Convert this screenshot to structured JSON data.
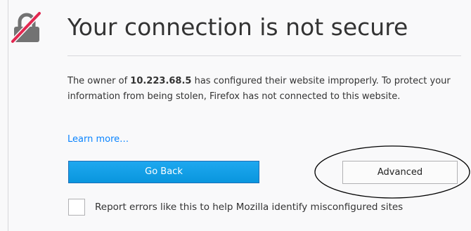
{
  "page": {
    "title": "Your connection is not secure",
    "description": {
      "before_host": "The owner of ",
      "host": "10.223.68.5",
      "after_host": " has configured their website improperly. To protect your information from being stolen, Firefox has not connected to this website."
    },
    "learn_more": "Learn more…",
    "go_back_label": "Go Back",
    "advanced_label": "Advanced",
    "report_label": "Report errors like this to help Mozilla identify misconfigured sites",
    "report_checked": false
  },
  "icons": {
    "lock": "broken-lock-icon"
  },
  "colors": {
    "background": "#f9f9fa",
    "primary_button": "#0a9ae0",
    "link": "#0a84ff",
    "strike": "#e22850",
    "lock_gray": "#737373"
  }
}
